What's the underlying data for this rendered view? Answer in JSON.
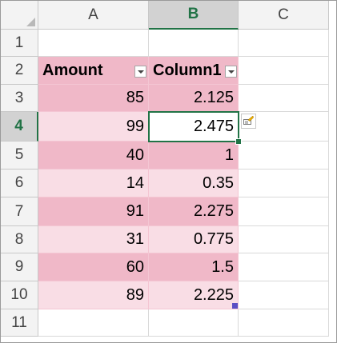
{
  "columns": [
    "A",
    "B",
    "C"
  ],
  "rows": [
    "1",
    "2",
    "3",
    "4",
    "5",
    "6",
    "7",
    "8",
    "9",
    "10",
    "11"
  ],
  "table": {
    "headers": [
      "Amount",
      "Column1"
    ],
    "data": [
      [
        "85",
        "2.125"
      ],
      [
        "99",
        "2.475"
      ],
      [
        "40",
        "1"
      ],
      [
        "14",
        "0.35"
      ],
      [
        "91",
        "2.275"
      ],
      [
        "31",
        "0.775"
      ],
      [
        "60",
        "1.5"
      ],
      [
        "89",
        "2.225"
      ]
    ]
  },
  "colors": {
    "selection": "#217346",
    "band_dark": "#f0b8c8",
    "band_light": "#f9dde5",
    "resize_handle": "#5b4fc4",
    "quick_analysis_icon": "#f5b800"
  }
}
